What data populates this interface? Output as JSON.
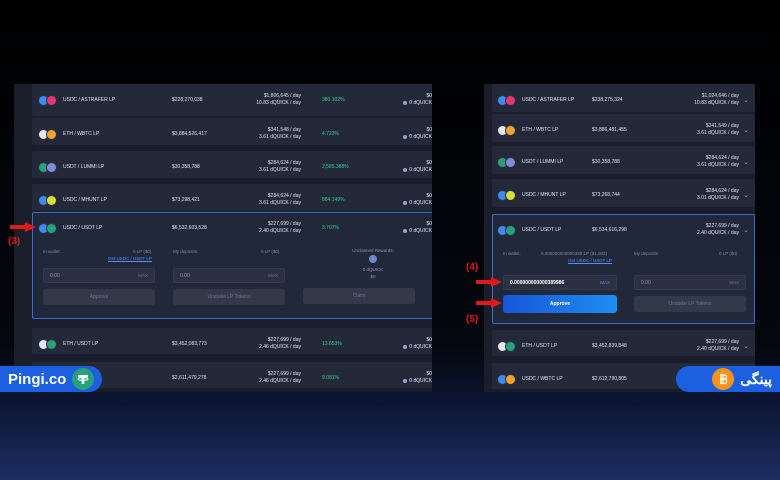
{
  "colors": {
    "accent": "#1c5fe0",
    "apr_green": "#2fd48e",
    "annotation_red": "#e01a1a",
    "panel_bg": "#191e2a",
    "row_bg": "#232939"
  },
  "left": {
    "rows": [
      {
        "pair": "USDC / ASTRAFER LP",
        "tvl": "$228,270,038",
        "rew1": "$1,806,645 / day",
        "rew2": "10.83 dQUICK / day",
        "apr": "380.102%",
        "earn1": "$0",
        "earn2": "0 dQUICK",
        "tokens": [
          "#3b8bf0",
          "#e8356e"
        ]
      },
      {
        "pair": "ETH / WBTC LP",
        "tvl": "$3,884,526,417",
        "rew1": "$341,548 / day",
        "rew2": "3.61 dQUICK / day",
        "apr": "4.723%",
        "earn1": "$0",
        "earn2": "0 dQUICK",
        "tokens": [
          "#e6e8ef",
          "#f2a32d"
        ]
      },
      {
        "pair": "USDT / LUMMI LP",
        "tvl": "$30,358,788",
        "rew1": "$284,624 / day",
        "rew2": "3.61 dQUICK / day",
        "apr": "2,585.388%",
        "earn1": "$0",
        "earn2": "0 dQUICK",
        "tokens": [
          "#26a17b",
          "#7f8bd8"
        ]
      },
      {
        "pair": "USDC / MHUNT LP",
        "tvl": "$73,298,421",
        "rew1": "$284,624 / day",
        "rew2": "3.61 dQUICK / day",
        "apr": "884.149%",
        "earn1": "$0",
        "earn2": "0 dQUICK",
        "tokens": [
          "#3b8bf0",
          "#d7e032"
        ]
      },
      {
        "pair": "USDC / USDT LP",
        "tvl": "$6,532,603,528",
        "rew1": "$227,699 / day",
        "rew2": "2.40 dQUICK / day",
        "apr": "3.707%",
        "earn1": "$0",
        "earn2": "0 dQUICK",
        "tokens": [
          "#3b8bf0",
          "#26a17b"
        ]
      },
      {
        "pair": "ETH / USDT LP",
        "tvl": "$3,452,083,773",
        "rew1": "$227,699 / day",
        "rew2": "2.46 dQUICK / day",
        "apr": "13.653%",
        "earn1": "$0",
        "earn2": "0 dQUICK",
        "tokens": [
          "#e6e8ef",
          "#26a17b"
        ]
      },
      {
        "pair": "",
        "tvl": "$2,611,479,278",
        "rew1": "$227,699 / day",
        "rew2": "2.46 dQUICK / day",
        "apr": "9.081%",
        "earn1": "$0",
        "earn2": "0 dQUICK",
        "tokens": [
          "#3b8bf0",
          "#f2a32d"
        ]
      }
    ],
    "expanded": {
      "in_wallet": "In wallet:",
      "wallet_lp": "0 LP ($0)",
      "get_link": "Get USDC / USDT LP",
      "my_deposits": "My deposits:",
      "deposit_lp": "0 LP ($0)",
      "unclaimed": "Unclaimed Rewards:",
      "unclaimed_q": "0 dQUICK",
      "unclaimed_usd": "$0",
      "input_value": "0.00",
      "input_max": "MAX",
      "deposit_value": "0.00",
      "deposit_max": "MAX",
      "approve": "Approve",
      "unstake": "Unstake LP Tokens",
      "claim": "Claim"
    },
    "label": "(3)"
  },
  "right": {
    "rows": [
      {
        "pair": "USDC / ASTRAFER LP",
        "tvl": "$238,275,324",
        "rew1": "$1,024,646 / day",
        "rew2": "10.83 dQUICK / day",
        "tokens": [
          "#3b8bf0",
          "#e8356e"
        ]
      },
      {
        "pair": "ETH / WBTC LP",
        "tvl": "$3,886,481,455",
        "rew1": "$341,549 / day",
        "rew2": "3.61 dQUICK / day",
        "tokens": [
          "#e6e8ef",
          "#f2a32d"
        ]
      },
      {
        "pair": "USDT / LUMMI LP",
        "tvl": "$30,358,788",
        "rew1": "$284,624 / day",
        "rew2": "3.61 dQUICK / day",
        "tokens": [
          "#26a17b",
          "#7f8bd8"
        ]
      },
      {
        "pair": "USDC / MHUNT LP",
        "tvl": "$73,268,744",
        "rew1": "$284,624 / day",
        "rew2": "3.01 dQUICK / day",
        "tokens": [
          "#3b8bf0",
          "#d7e032"
        ]
      },
      {
        "pair": "USDC / USDT LP",
        "tvl": "$6,534,616,298",
        "rew1": "$227,699 / day",
        "rew2": "2.40 dQUICK / day",
        "tokens": [
          "#3b8bf0",
          "#26a17b"
        ]
      },
      {
        "pair": "ETH / USDT LP",
        "tvl": "$3,452,839,848",
        "rew1": "$227,699 / day",
        "rew2": "2.40 dQUICK / day",
        "tokens": [
          "#e6e8ef",
          "#26a17b"
        ]
      },
      {
        "pair": "USDC / WBTC LP",
        "tvl": "$2,612,790,805",
        "rew1": "$227,699 / day",
        "rew2": "2.40 dQUICK / day",
        "tokens": [
          "#3b8bf0",
          "#f2a32d"
        ]
      }
    ],
    "expanded": {
      "in_wallet": "In wallet:",
      "wallet_lp": "0.000000000000389 LP ($1,002)",
      "get_link": "Get USDC / USDT LP",
      "my_deposits": "My deposits:",
      "deposit_lp": "0 LP ($0)",
      "input_value": "0.000000000000389986",
      "input_max": "MAX",
      "deposit_value": "0.00",
      "deposit_max": "MAX",
      "approve": "Approve",
      "unstake": "Unstake LP Tokens"
    },
    "label4": "(4)",
    "label5": "(5)"
  },
  "brand": {
    "left": "Pingi.co",
    "right": "پینگی"
  }
}
